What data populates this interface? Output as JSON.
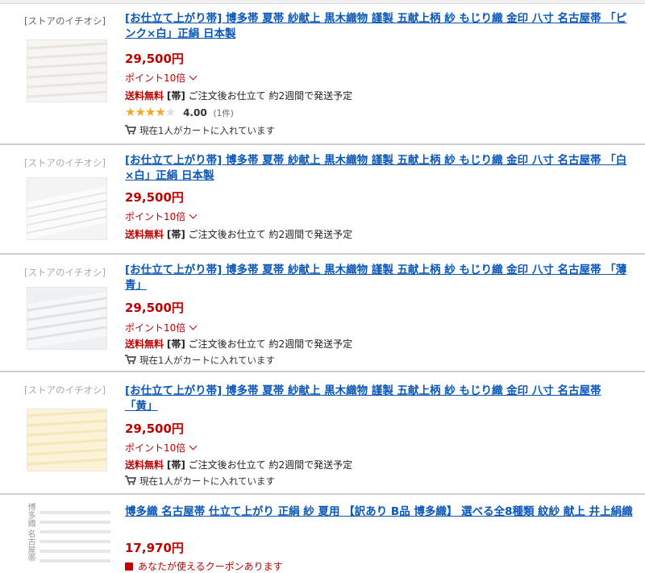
{
  "items": [
    {
      "badge": "[ストアのイチオシ]",
      "title_a": "[お仕立て上がり帯] 博多帯 夏帯 紗献上 黒木織物 謹製 五献上柄 紗 もじり織 金印 八寸 名古屋帯",
      "title_b": "「ピンク×白」正絹 日本製",
      "price": "29,500円",
      "point": "ポイント10倍",
      "ship_free": "送料無料",
      "ship_tag": "[帯]",
      "ship_text": "ご注文後お仕立て 約2週間で発送予定",
      "rating_score": "4.00",
      "rating_count": "(1件)",
      "cart_text": "現在1人がカートに入れています"
    },
    {
      "badge": "[ストアのイチオシ]",
      "title_a": "[お仕立て上がり帯] 博多帯 夏帯 紗献上 黒木織物 謹製 五献上柄 紗 もじり織 金印 八寸 名古屋帯",
      "title_b": "「白×白」正絹 日本製",
      "price": "29,500円",
      "point": "ポイント10倍",
      "ship_free": "送料無料",
      "ship_tag": "[帯]",
      "ship_text": "ご注文後お仕立て 約2週間で発送予定"
    },
    {
      "badge": "[ストアのイチオシ]",
      "title_a": "[お仕立て上がり帯] 博多帯 夏帯 紗献上 黒木織物 謹製 五献上柄 紗 もじり織 金印 八寸 名古屋帯",
      "title_b": "「薄青」",
      "price": "29,500円",
      "point": "ポイント10倍",
      "ship_free": "送料無料",
      "ship_tag": "[帯]",
      "ship_text": "ご注文後お仕立て 約2週間で発送予定",
      "cart_text": "現在1人がカートに入れています"
    },
    {
      "badge": "[ストアのイチオシ]",
      "title_a": "[お仕立て上がり帯] 博多帯 夏帯 紗献上 黒木織物 謹製 五献上柄 紗 もじり織 金印 八寸 名古屋帯",
      "title_b": "「黄」",
      "price": "29,500円",
      "point": "ポイント10倍",
      "ship_free": "送料無料",
      "ship_tag": "[帯]",
      "ship_text": "ご注文後お仕立て 約2週間で発送予定",
      "cart_text": "現在1人がカートに入れています"
    },
    {
      "title": "博多織 名古屋帯 仕立て上がり 正絹 紗 夏用 【訳あり B品 博多織】 選べる全8種類 紋紗 献上 井上絹織",
      "price": "17,970円",
      "coupon": "あなたが使えるクーポンあります",
      "thumb_text": "博多織 名古屋帯"
    }
  ],
  "colors": {
    "link": "#0b57b8",
    "price": "#bf0000",
    "star": "#f5a623"
  },
  "rating_stars": 4
}
